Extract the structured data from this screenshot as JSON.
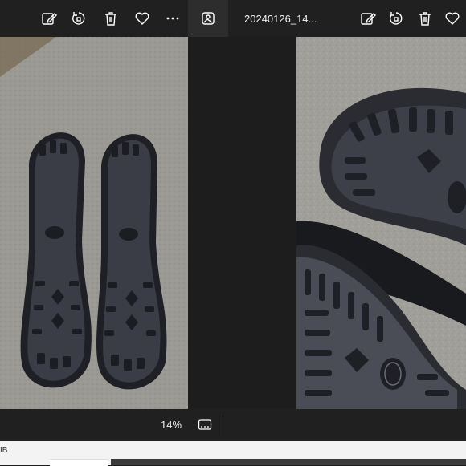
{
  "toolbar": {
    "left_icons": [
      "edit-image-icon",
      "rotate-icon",
      "delete-icon",
      "favorite-icon",
      "more-icon"
    ],
    "filmstrip_toggle_icon": "image-gallery-icon",
    "filename": "20240126_14...",
    "right_icons": [
      "edit-image-icon",
      "rotate-icon",
      "delete-icon",
      "favorite-icon"
    ]
  },
  "status": {
    "zoom": "14%"
  },
  "bottom": {
    "text": "IB"
  }
}
